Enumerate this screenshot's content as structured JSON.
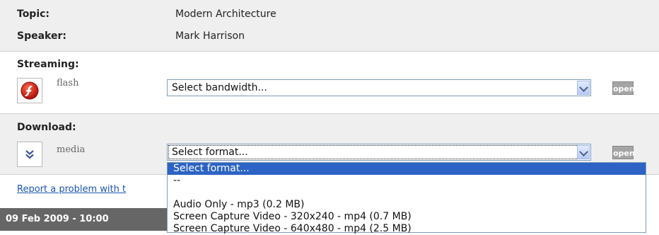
{
  "info": {
    "topic_label": "Topic:",
    "topic_value": "Modern Architecture",
    "speaker_label": "Speaker:",
    "speaker_value": "Mark Harrison"
  },
  "streaming": {
    "heading": "Streaming:",
    "type_label": "flash",
    "select_value": "Select bandwidth...",
    "open_label": "open",
    "icon": "flash-icon"
  },
  "download": {
    "heading": "Download:",
    "type_label": "media",
    "select_value": "Select format...",
    "open_label": "open",
    "icon": "chevron-down-icon",
    "options": [
      "Select format...",
      "--",
      "",
      "Audio Only - mp3 (0.2 MB)",
      "Screen Capture Video - 320x240 - mp4 (0.7 MB)",
      "Screen Capture Video - 640x480 - mp4 (2.5 MB)"
    ]
  },
  "report_link": "Report a problem with t",
  "date": "09 Feb 2009 - 10:00",
  "colors": {
    "selection": "#2c63c4",
    "open_button": "#a5a5a5",
    "link": "#1a56b1"
  }
}
